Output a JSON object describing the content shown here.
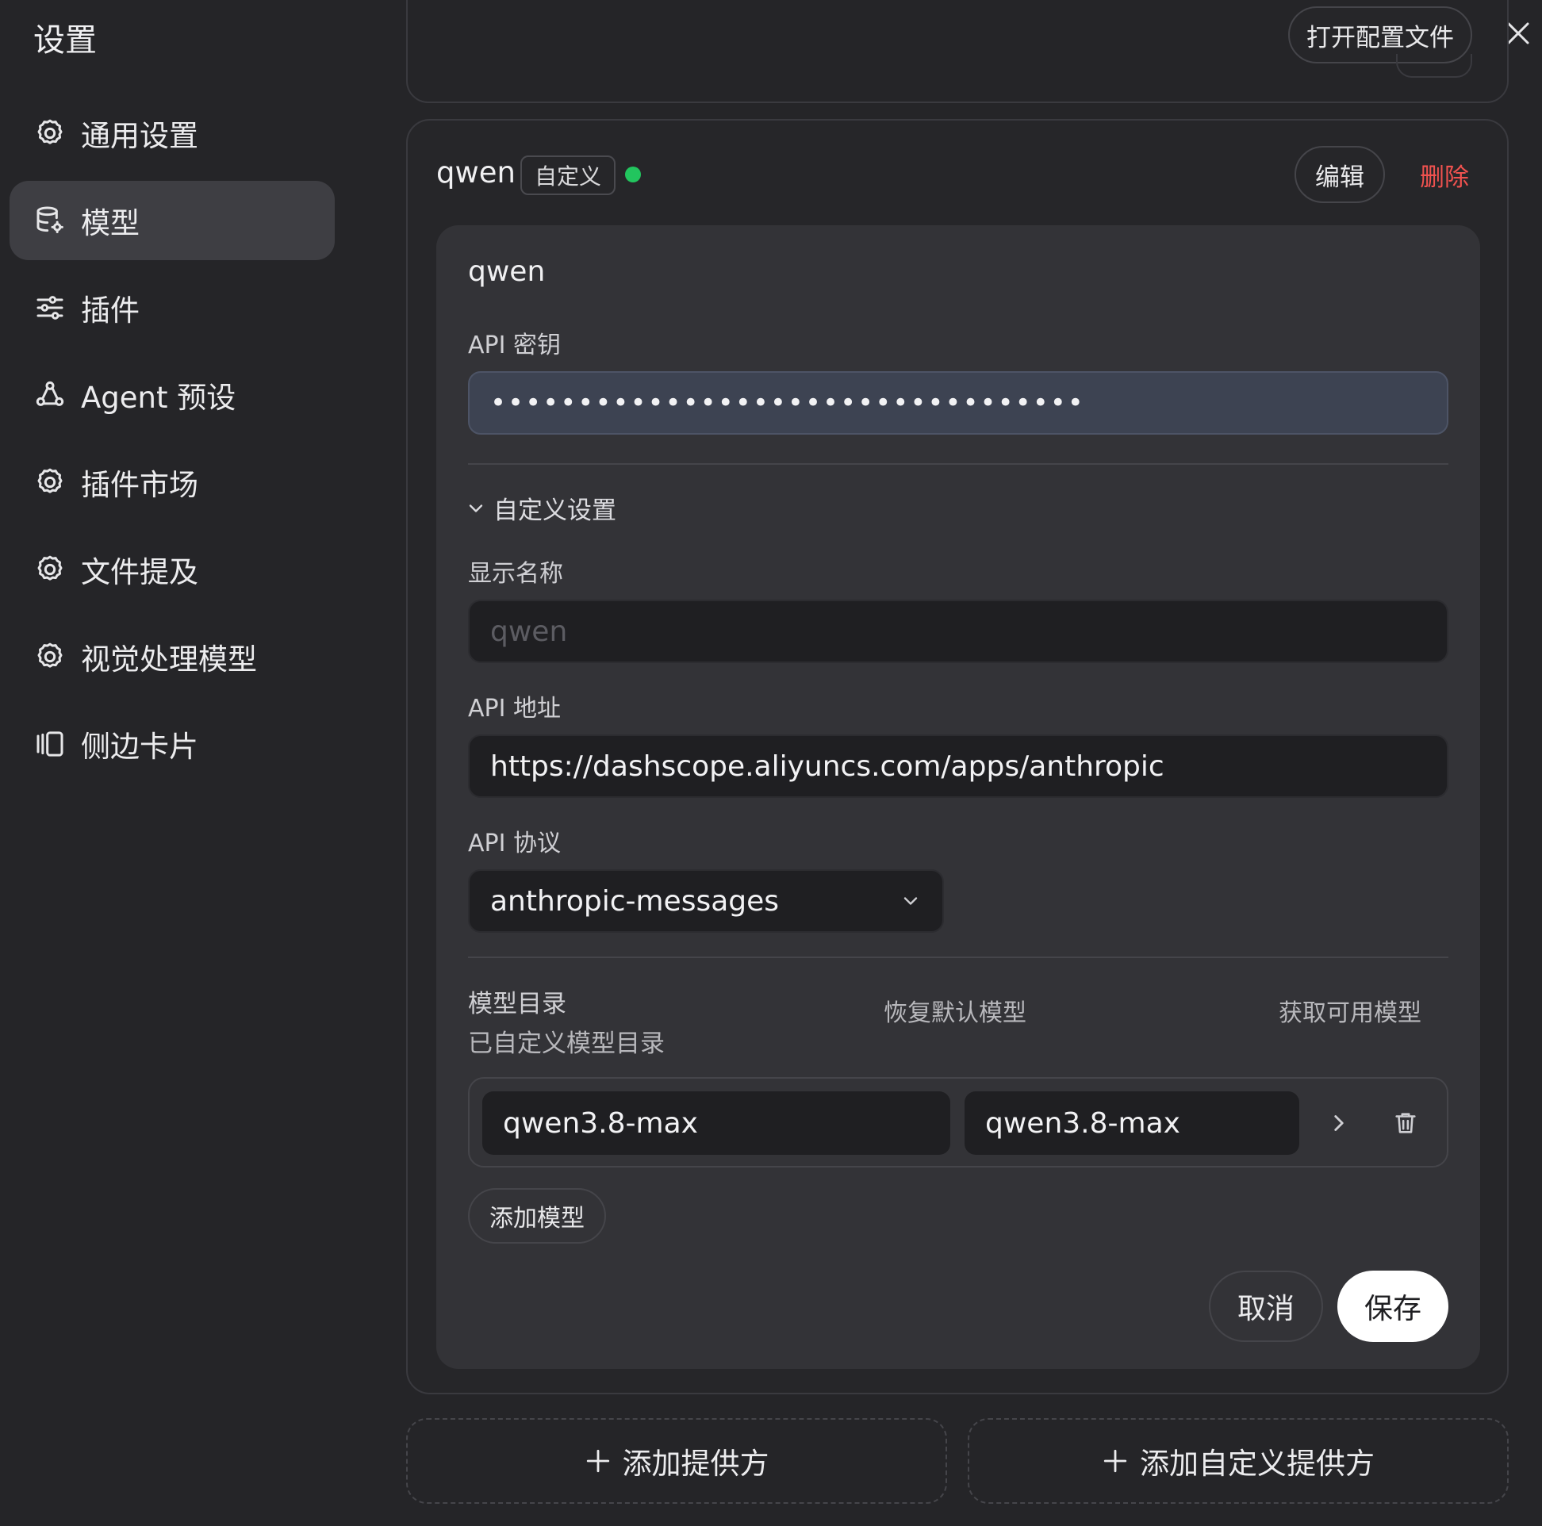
{
  "app": {
    "title": "设置"
  },
  "sidebar": {
    "items": [
      {
        "label": "通用设置",
        "icon": "gear-icon"
      },
      {
        "label": "模型",
        "icon": "database-gear-icon",
        "active": true
      },
      {
        "label": "插件",
        "icon": "sliders-icon"
      },
      {
        "label": "Agent 预设",
        "icon": "agent-icon"
      },
      {
        "label": "插件市场",
        "icon": "gear-icon"
      },
      {
        "label": "文件提及",
        "icon": "gear-icon"
      },
      {
        "label": "视觉处理模型",
        "icon": "gear-icon"
      },
      {
        "label": "侧边卡片",
        "icon": "side-card-icon"
      }
    ]
  },
  "header": {
    "open_config_label": "打开配置文件",
    "close_icon": "close-icon"
  },
  "provider": {
    "name": "qwen",
    "tag": "自定义",
    "status_color": "#22c55e",
    "edit_label": "编辑",
    "delete_label": "删除",
    "panel_title": "qwen",
    "api_key_label": "API 密钥",
    "api_key_value": "••••••••••••••••••••••••••••••••••",
    "custom_section_label": "自定义设置",
    "display_name_label": "显示名称",
    "display_name_placeholder": "qwen",
    "api_url_label": "API 地址",
    "api_url_value": "https://dashscope.aliyuncs.com/apps/anthropic",
    "api_protocol_label": "API 协议",
    "api_protocol_value": "anthropic-messages",
    "catalog_title": "模型目录",
    "catalog_subtitle": "已自定义模型目录",
    "restore_default_label": "恢复默认模型",
    "fetch_models_label": "获取可用模型",
    "models": [
      {
        "id": "qwen3.8-max",
        "name": "qwen3.8-max"
      }
    ],
    "add_model_label": "添加模型",
    "cancel_label": "取消",
    "save_label": "保存"
  },
  "footer": {
    "add_provider_label": "添加提供方",
    "add_custom_provider_label": "添加自定义提供方"
  }
}
